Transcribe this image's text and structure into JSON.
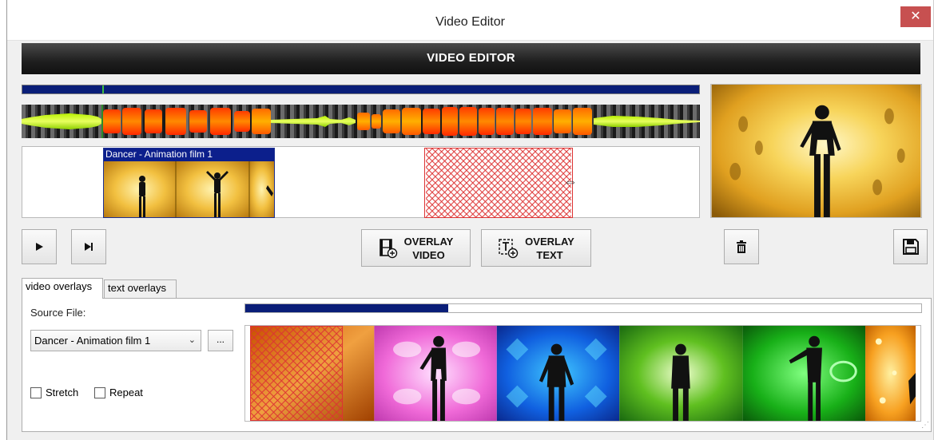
{
  "window": {
    "title": "Video Editor",
    "close_glyph": "✕"
  },
  "header": {
    "title": "VIDEO EDITOR"
  },
  "timeline": {
    "playhead_position": 0.12,
    "clip": {
      "label": "Dancer - Animation film 1"
    },
    "resize_cursor": "⇔"
  },
  "buttons": {
    "play_icon": "play-icon",
    "next_icon": "skip-next-icon",
    "overlay_video_line1": "OVERLAY",
    "overlay_video_line2": "VIDEO",
    "overlay_text_line1": "OVERLAY",
    "overlay_text_line2": "TEXT",
    "delete_icon": "trash-icon",
    "save_icon": "save-icon"
  },
  "tabs": [
    {
      "label": "video overlays",
      "active": true
    },
    {
      "label": "text overlays",
      "active": false
    }
  ],
  "panel": {
    "source_label": "Source File:",
    "source_value": "Dancer - Animation film 1",
    "browse_label": "...",
    "stretch_label": "Stretch",
    "stretch_checked": false,
    "repeat_label": "Repeat",
    "repeat_checked": false,
    "source_progress": 0.3
  },
  "colors": {
    "accent_blue": "#0a1e78",
    "overlay_red": "#d33333",
    "header_dark": "#1e1e1e"
  }
}
